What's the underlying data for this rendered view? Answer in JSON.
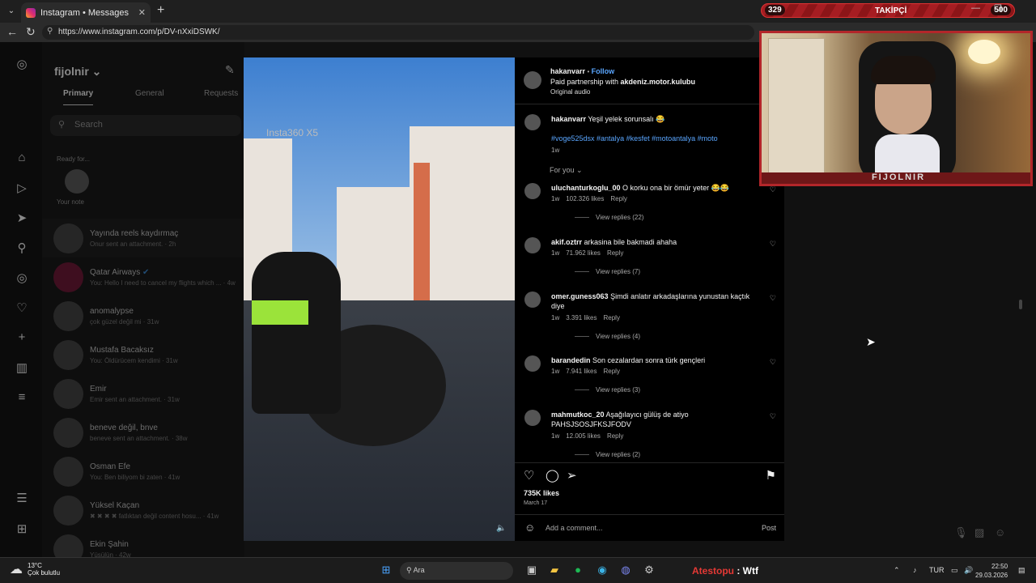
{
  "browser": {
    "tab_title": "Instagram • Messages",
    "url": "https://www.instagram.com/p/DV-nXxiDSWK/"
  },
  "dm": {
    "username": "fijolnir",
    "tabs": [
      "Primary",
      "General",
      "Requests"
    ],
    "search_placeholder": "Search",
    "note_label": "Ready for...",
    "your_note": "Your note",
    "conversations": [
      {
        "name": "Yayında reels kaydırmaç",
        "preview": "Onur sent an attachment. · 2h"
      },
      {
        "name": "Qatar Airways",
        "preview": "You: Hello I need to cancel my flights which ... · 4w"
      },
      {
        "name": "anomalypse",
        "preview": "çok güzel değil mi · 31w"
      },
      {
        "name": "Mustafa Bacaksız",
        "preview": "You: Öldürücem kendimi · 31w"
      },
      {
        "name": "Emir",
        "preview": "Emir sent an attachment. · 31w"
      },
      {
        "name": "beneve değil, bnve",
        "preview": "beneve sent an attachment. · 38w"
      },
      {
        "name": "Osman Efe",
        "preview": "You: Ben biliyom bi zaten · 41w"
      },
      {
        "name": "Yüksel Kaçan",
        "preview": "✖ ✖ ✖ ✖ fatlıktan değil content hosu... · 41w"
      },
      {
        "name": "Ekin Şahin",
        "preview": "Yüsülün · 42w"
      }
    ]
  },
  "video": {
    "watermark_main": "Insta360",
    "watermark_model": "X5"
  },
  "post": {
    "author": "hakanvarr",
    "follow": "Follow",
    "partnership_prefix": "Paid partnership with ",
    "partner": "akdeniz.motor.kulubu",
    "audio": "Original audio",
    "caption_user": "hakanvarr",
    "caption": "Yeşil yelek sorunsalı 😂",
    "hashtags": "#voge525dsx #antalya #kesfet #motoantalya #moto",
    "caption_age": "1w",
    "for_you": "For you ⌄",
    "reply_label": "Reply",
    "comments": [
      {
        "user": "uluchanturkoglu_00",
        "text": "O korku ona bir ömür yeter 😂😂",
        "age": "1w",
        "likes": "102.326 likes",
        "replies": "View replies (22)"
      },
      {
        "user": "akif.oztrr",
        "text": "arkasina bile bakmadi ahaha",
        "age": "1w",
        "likes": "71.962 likes",
        "replies": "View replies (7)"
      },
      {
        "user": "omer.guness063",
        "text": "Şimdi anlatır arkadaşlarına yunustan kaçtık diye",
        "age": "1w",
        "likes": "3.391 likes",
        "replies": "View replies (4)"
      },
      {
        "user": "barandedin",
        "text": "Son cezalardan sonra türk gençleri",
        "age": "1w",
        "likes": "7.941 likes",
        "replies": "View replies (3)"
      },
      {
        "user": "mahmutkoc_20",
        "text": "Aşağılayıcı gülüş de atiyo PAHSJSOSJFKSJFODV",
        "age": "1w",
        "likes": "12.005 likes",
        "replies": "View replies (2)"
      }
    ],
    "likes_total": "735K likes",
    "date": "March 17",
    "comment_placeholder": "Add a comment...",
    "post_button": "Post"
  },
  "overlay": {
    "followers_current": "329",
    "followers_label": "TAKİPÇİ",
    "followers_goal": "500",
    "webcam_logo": "FIJOLNIR"
  },
  "taskbar": {
    "temp": "13°C",
    "weather": "Çok bulutlu",
    "search": "Ara",
    "ticker_name": "Atestopu",
    "ticker_text": " : Wtf",
    "lang": "TUR",
    "time": "22:50",
    "date": "29.03.2026"
  }
}
